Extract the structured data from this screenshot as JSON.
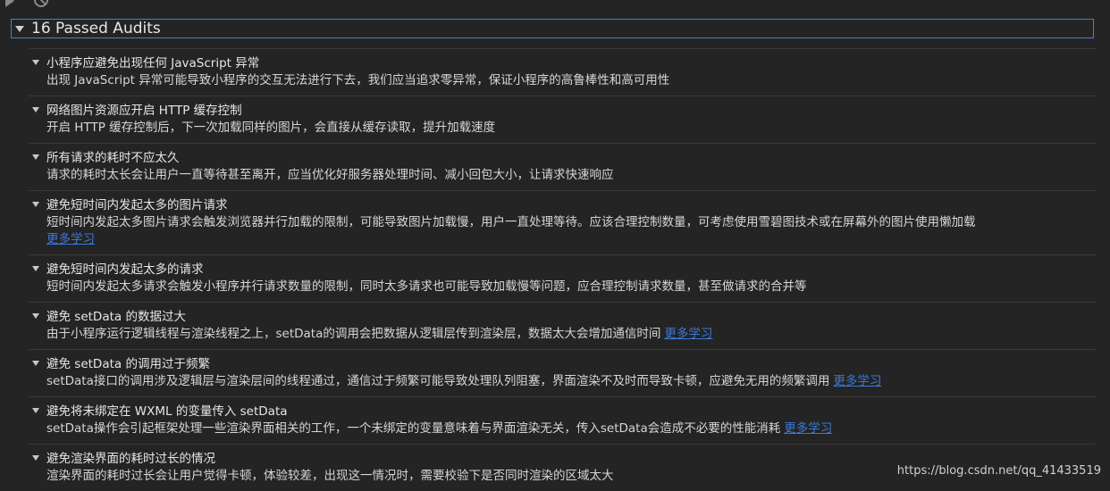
{
  "group": {
    "title": "16 Passed Audits"
  },
  "audits": [
    {
      "title": "小程序应避免出现任何 JavaScript 异常",
      "desc": "出现 JavaScript 异常可能导致小程序的交互无法进行下去，我们应当追求零异常，保证小程序的高鲁棒性和高可用性"
    },
    {
      "title": "网络图片资源应开启 HTTP 缓存控制",
      "desc": "开启 HTTP 缓存控制后，下一次加载同样的图片，会直接从缓存读取，提升加载速度"
    },
    {
      "title": "所有请求的耗时不应太久",
      "desc": "请求的耗时太长会让用户一直等待甚至离开，应当优化好服务器处理时间、减小回包大小，让请求快速响应"
    },
    {
      "title": "避免短时间内发起太多的图片请求",
      "desc": "短时间内发起太多图片请求会触发浏览器并行加载的限制，可能导致图片加载慢，用户一直处理等待。应该合理控制数量，可考虑使用雪碧图技术或在屏幕外的图片使用懒加载",
      "link": "更多学习"
    },
    {
      "title": "避免短时间内发起太多的请求",
      "desc": "短时间内发起太多请求会触发小程序并行请求数量的限制，同时太多请求也可能导致加载慢等问题，应合理控制请求数量，甚至做请求的合并等"
    },
    {
      "title": "避免 setData 的数据过大",
      "desc": "由于小程序运行逻辑线程与渲染线程之上，setData的调用会把数据从逻辑层传到渲染层，数据太大会增加通信时间",
      "link": "更多学习"
    },
    {
      "title": "避免 setData 的调用过于频繁",
      "desc": "setData接口的调用涉及逻辑层与渲染层间的线程通过，通信过于频繁可能导致处理队列阻塞，界面渲染不及时而导致卡顿，应避免无用的频繁调用",
      "link": "更多学习"
    },
    {
      "title": "避免将未绑定在 WXML 的变量传入 setData",
      "desc": "setData操作会引起框架处理一些渲染界面相关的工作，一个未绑定的变量意味着与界面渲染无关，传入setData会造成不必要的性能消耗",
      "link": "更多学习"
    },
    {
      "title": "避免渲染界面的耗时过长的情况",
      "desc": "渲染界面的耗时过长会让用户觉得卡顿，体验较差，出现这一情况时，需要校验下是否同时渲染的区域太大"
    }
  ],
  "watermark": "https://blog.csdn.net/qq_41433519"
}
